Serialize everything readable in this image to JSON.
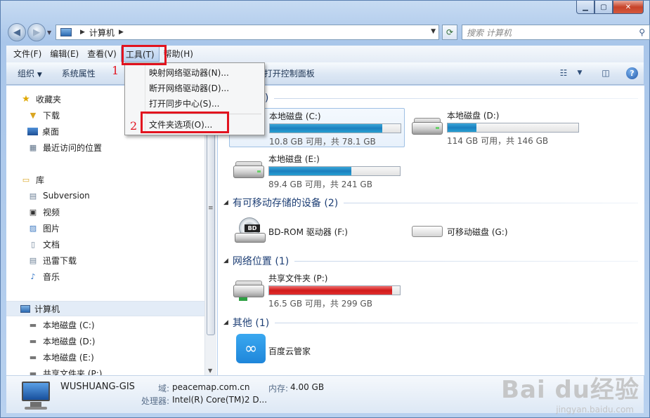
{
  "address": {
    "location": "计算机",
    "search_placeholder": "搜索 计算机"
  },
  "menubar": [
    {
      "label": "文件(F)"
    },
    {
      "label": "编辑(E)"
    },
    {
      "label": "查看(V)"
    },
    {
      "label": "工具(T)"
    },
    {
      "label": "帮助(H)"
    }
  ],
  "toolbar": {
    "organize": "组织",
    "system_properties": "系统属性",
    "control_panel": "打开控制面板"
  },
  "tools_menu": {
    "items": [
      {
        "label": "映射网络驱动器(N)..."
      },
      {
        "label": "断开网络驱动器(D)..."
      },
      {
        "label": "打开同步中心(S)..."
      },
      {
        "label": "文件夹选项(O)..."
      }
    ]
  },
  "annotations": {
    "step1": "1",
    "step2": "2"
  },
  "nav": {
    "favorites": {
      "label": "收藏夹",
      "items": [
        {
          "label": "下载"
        },
        {
          "label": "桌面"
        },
        {
          "label": "最近访问的位置"
        }
      ]
    },
    "libraries": {
      "label": "库",
      "items": [
        {
          "label": "Subversion"
        },
        {
          "label": "视频"
        },
        {
          "label": "图片"
        },
        {
          "label": "文档"
        },
        {
          "label": "迅雷下载"
        },
        {
          "label": "音乐"
        }
      ]
    },
    "computer": {
      "label": "计算机",
      "items": [
        {
          "label": "本地磁盘 (C:)"
        },
        {
          "label": "本地磁盘 (D:)"
        },
        {
          "label": "本地磁盘 (E:)"
        },
        {
          "label": "共享文件夹 (P:)"
        }
      ]
    }
  },
  "content": {
    "hdd_group_suffix": "3)",
    "drives": [
      {
        "name": "本地磁盘 (C:)",
        "info": "10.8 GB 可用，共 78.1 GB",
        "used_fraction": 0.86
      },
      {
        "name": "本地磁盘 (D:)",
        "info": "114 GB 可用，共 146 GB",
        "used_fraction": 0.22
      },
      {
        "name": "本地磁盘 (E:)",
        "info": "89.4 GB 可用，共 241 GB",
        "used_fraction": 0.63
      }
    ],
    "removable_group": "有可移动存储的设备 (2)",
    "removable": [
      {
        "name": "BD-ROM 驱动器 (F:)"
      },
      {
        "name": "可移动磁盘 (G:)"
      }
    ],
    "network_group": "网络位置 (1)",
    "network": [
      {
        "name": "共享文件夹 (P:)",
        "info": "16.5 GB 可用，共 299 GB",
        "used_fraction": 0.94
      }
    ],
    "other_group": "其他 (1)",
    "other": [
      {
        "name": "百度云管家"
      }
    ]
  },
  "details": {
    "computer_name": "WUSHUANG-GIS",
    "domain_label": "域:",
    "domain_value": "peacemap.com.cn",
    "memory_label": "内存:",
    "memory_value": "4.00 GB",
    "cpu_label": "处理器:",
    "cpu_value": "Intel(R) Core(TM)2 D..."
  },
  "watermark": {
    "main": "Bai du经验",
    "sub": "jingyan.baidu.com"
  },
  "colors": {
    "highlight_red": "#e2131f",
    "bar_blue": "#1c7fbf",
    "bar_red": "#d11a1a"
  }
}
